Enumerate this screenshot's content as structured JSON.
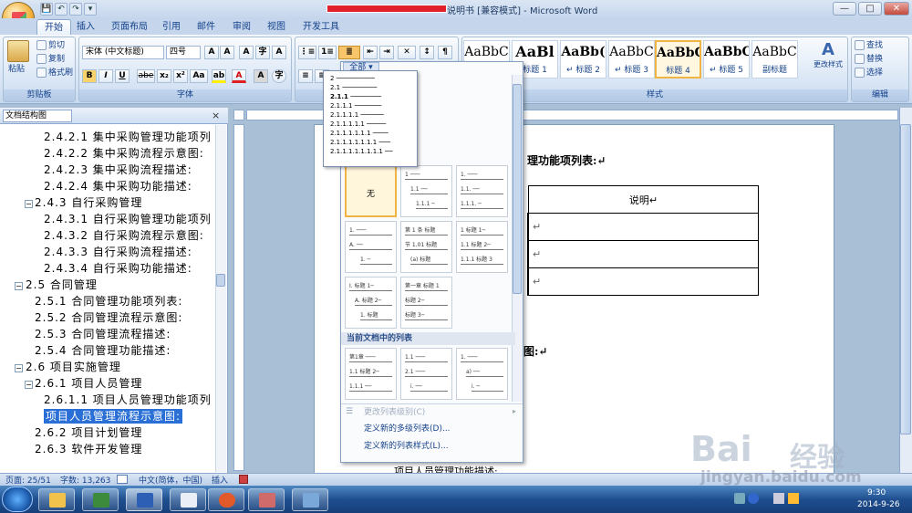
{
  "window": {
    "title": "说明书 [兼容模式] - Microsoft Word",
    "min": "—",
    "max": "□",
    "close": "✕"
  },
  "qat": [
    "💾",
    "↶",
    "↷",
    "▾"
  ],
  "tabs": [
    "开始",
    "插入",
    "页面布局",
    "引用",
    "邮件",
    "审阅",
    "视图",
    "开发工具"
  ],
  "ribbon": {
    "clipboard": {
      "label": "剪贴板",
      "paste": "粘贴",
      "cut": "剪切",
      "copy": "复制",
      "format_painter": "格式刷"
    },
    "font": {
      "label": "字体",
      "font_name": "宋体 (中文标题)",
      "font_size": "四号",
      "bold": "B",
      "italic": "I",
      "underline": "U",
      "strike": "abe",
      "sub": "x₂",
      "sup": "x²",
      "case": "Aa",
      "grow": "A",
      "shrink": "A",
      "clear": "A",
      "highlight": "ab",
      "color": "A",
      "border": "A",
      "enclose": "字"
    },
    "paragraph": {
      "label": "段落"
    },
    "styles": {
      "label": "样式",
      "items": [
        {
          "preview": "AaBbC",
          "name": ""
        },
        {
          "preview": "AaBl",
          "name": "标题 1"
        },
        {
          "preview": "AaBb(",
          "name": "↵ 标题 2"
        },
        {
          "preview": "AaBbC",
          "name": "↵ 标题 3"
        },
        {
          "preview": "AaBbC",
          "name": "标题 4"
        },
        {
          "preview": "AaBbC",
          "name": "↵ 标题 5"
        },
        {
          "preview": "AaBbC",
          "name": "副标题"
        }
      ],
      "change": "更改样式"
    },
    "editing": {
      "label": "编辑",
      "find": "查找",
      "replace": "替换",
      "select": "选择"
    }
  },
  "nav": {
    "selector": "文档结构图",
    "close": "×",
    "items": [
      {
        "text": "2.4.2.1 集中采购管理功能项列"
      },
      {
        "text": "2.4.2.2 集中采购流程示意图:"
      },
      {
        "text": "2.4.2.3 集中采购流程描述:"
      },
      {
        "text": "2.4.2.4 集中采购功能描述:"
      },
      {
        "text": "2.4.3 自行采购管理"
      },
      {
        "text": "2.4.3.1 自行采购管理功能项列"
      },
      {
        "text": "2.4.3.2 自行采购流程示意图:"
      },
      {
        "text": "2.4.3.3 自行采购流程描述:"
      },
      {
        "text": "2.4.3.4 自行采购功能描述:"
      },
      {
        "text": "2.5 合同管理"
      },
      {
        "text": "2.5.1 合同管理功能项列表:"
      },
      {
        "text": "2.5.2 合同管理流程示意图:"
      },
      {
        "text": "2.5.3 合同管理流程描述:"
      },
      {
        "text": "2.5.4 合同管理功能描述:"
      },
      {
        "text": "2.6 项目实施管理"
      },
      {
        "text": "2.6.1 项目人员管理"
      },
      {
        "text": "2.6.1.1 项目人员管理功能项列"
      },
      {
        "text": "项目人员管理流程示意图:"
      },
      {
        "text": "2.6.2 项目计划管理"
      },
      {
        "text": "2.6.3 软件开发管理"
      }
    ]
  },
  "dropdown": {
    "filter": "全部 ▾",
    "popover": [
      "2",
      "2.1",
      "2.1.1",
      "2.1.1.1",
      "2.1.1.1.1",
      "2.1.1.1.1.1",
      "2.1.1.1.1.1.1",
      "2.1.1.1.1.1.1.1",
      "2.1.1.1.1.1.1.1.1"
    ],
    "none": "无",
    "section_current": "当前文档中的列表",
    "menu": [
      "更改列表级别(C)",
      "定义新的多级列表(D)...",
      "定义新的列表样式(L)..."
    ]
  },
  "doc": {
    "heading": "理功能项列表:↵",
    "col_header": "说明↵",
    "cellmark": "↵",
    "heading2": "图:↵",
    "bottom": "项目人员管理功能描述:"
  },
  "status": {
    "page": "页面: 25/51",
    "words": "字数: 13,263",
    "lang": "中文(简体，中国)",
    "insert": "插入"
  },
  "tray": {
    "time": "9:30",
    "date": "2014-9-26"
  },
  "watermark": {
    "brand": "Bai",
    "brand2": "经验",
    "url": "jingyan.baidu.com"
  }
}
